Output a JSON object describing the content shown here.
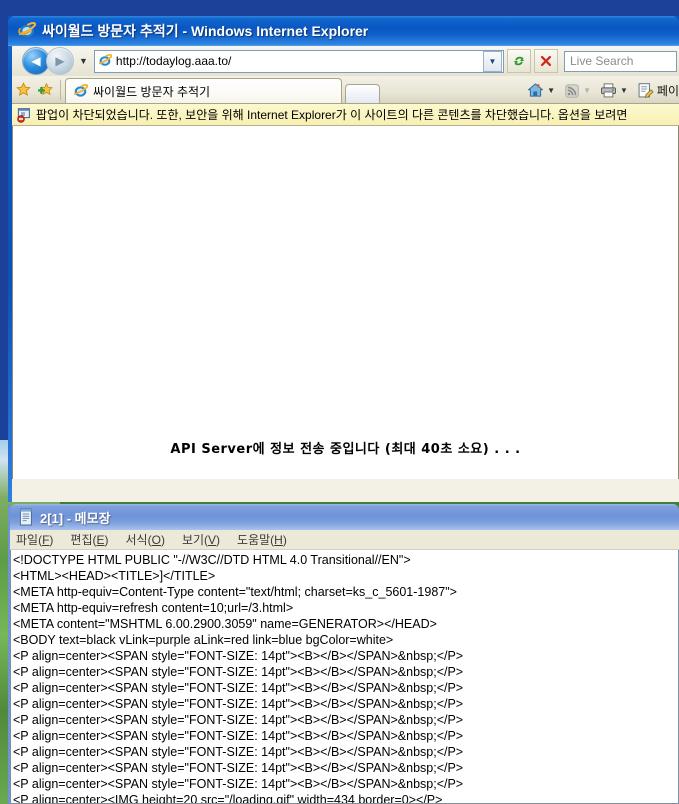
{
  "desktop": {
    "background_color": "#1b4298",
    "wallpaper_name": "bliss-wallpaper"
  },
  "browser": {
    "window_title": "싸이월드 방문자 추적기 - Windows Internet Explorer",
    "title_icon": "internet-explorer-icon",
    "navigation": {
      "back_label": "◀",
      "forward_label": "▶",
      "history_caret": "▼"
    },
    "address": {
      "favicon": "internet-explorer-favicon",
      "url": "http://todaylog.aaa.to/",
      "dropdown_caret": "▼"
    },
    "buttons": {
      "refresh_label": "↻",
      "stop_label": "✕"
    },
    "search": {
      "placeholder": "Live Search",
      "value": ""
    },
    "favorites": {
      "favorites_center_icon": "star-icon",
      "add_favorite_icon": "star-plus-icon"
    },
    "tabs": [
      {
        "label": "싸이월드 방문자 추적기",
        "favicon": "internet-explorer-favicon",
        "active": true
      }
    ],
    "new_tab_label": "",
    "toolbar": {
      "home_icon": "home-icon",
      "home_caret": "▼",
      "feeds_icon": "rss-icon",
      "feeds_caret": "▼",
      "print_icon": "printer-icon",
      "print_caret": "▼",
      "page_icon": "page-edit-icon",
      "page_menu_label": "페이"
    },
    "info_bar": {
      "icon": "popup-blocked-icon",
      "text": "팝업이 차단되었습니다. 또한, 보안을 위해 Internet Explorer가 이 사이트의 다른 콘텐츠를 차단했습니다. 옵션을 보려면"
    },
    "page": {
      "background_color": "#ffffff",
      "message": "API Server에 정보 전송 중입니다 (최대 40초 소요) . . ."
    }
  },
  "notepad": {
    "window_title": "2[1] - 메모장",
    "title_icon": "notepad-icon",
    "menu": [
      {
        "label": "파일(F)",
        "pre": "파일(",
        "accel": "F",
        "post": ")"
      },
      {
        "label": "편집(E)",
        "pre": "편집(",
        "accel": "E",
        "post": ")"
      },
      {
        "label": "서식(O)",
        "pre": "서식(",
        "accel": "O",
        "post": ")"
      },
      {
        "label": "보기(V)",
        "pre": "보기(",
        "accel": "V",
        "post": ")"
      },
      {
        "label": "도움말(H)",
        "pre": "도움말(",
        "accel": "H",
        "post": ")"
      }
    ],
    "content_lines": [
      "<!DOCTYPE HTML PUBLIC \"-//W3C//DTD HTML 4.0 Transitional//EN\">",
      "<HTML><HEAD><TITLE>]</TITLE>",
      "<META http-equiv=Content-Type content=\"text/html; charset=ks_c_5601-1987\">",
      "<META http-equiv=refresh content=10;url=/3.html>",
      "<META content=\"MSHTML 6.00.2900.3059\" name=GENERATOR></HEAD>",
      "<BODY text=black vLink=purple aLink=red link=blue bgColor=white>",
      "<P align=center><SPAN style=\"FONT-SIZE: 14pt\"><B></B></SPAN>&nbsp;</P>",
      "<P align=center><SPAN style=\"FONT-SIZE: 14pt\"><B></B></SPAN>&nbsp;</P>",
      "<P align=center><SPAN style=\"FONT-SIZE: 14pt\"><B></B></SPAN>&nbsp;</P>",
      "<P align=center><SPAN style=\"FONT-SIZE: 14pt\"><B></B></SPAN>&nbsp;</P>",
      "<P align=center><SPAN style=\"FONT-SIZE: 14pt\"><B></B></SPAN>&nbsp;</P>",
      "<P align=center><SPAN style=\"FONT-SIZE: 14pt\"><B></B></SPAN>&nbsp;</P>",
      "<P align=center><SPAN style=\"FONT-SIZE: 14pt\"><B></B></SPAN>&nbsp;</P>",
      "<P align=center><SPAN style=\"FONT-SIZE: 14pt\"><B></B></SPAN>&nbsp;</P>",
      "<P align=center><SPAN style=\"FONT-SIZE: 14pt\"><B></B></SPAN>&nbsp;</P>",
      "<P align=center><IMG height=20 src=\"/loading.gif\" width=434 border=0></P>"
    ]
  }
}
